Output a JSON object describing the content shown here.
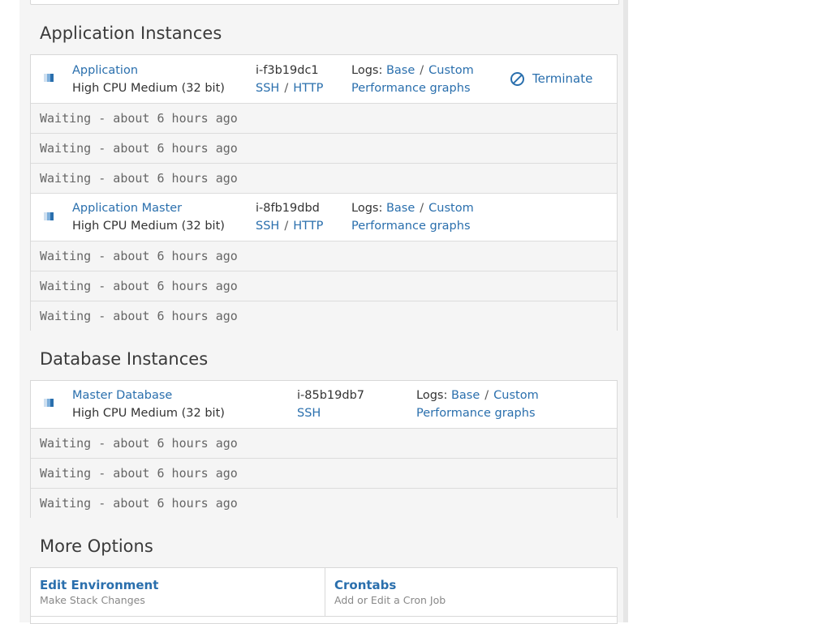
{
  "sections": {
    "application_title": "Application Instances",
    "database_title": "Database Instances",
    "options_title": "More Options"
  },
  "labels": {
    "logs": "Logs:",
    "base": "Base",
    "custom": "Custom",
    "slash": "/",
    "perf": "Performance graphs",
    "ssh": "SSH",
    "http": "HTTP",
    "terminate": "Terminate"
  },
  "app_instances": [
    {
      "name": "Application",
      "type": "High CPU Medium (32 bit)",
      "id": "i-f3b19dc1",
      "waits": [
        "Waiting - about 6 hours ago",
        "Waiting - about 6 hours ago",
        "Waiting - about 6 hours ago"
      ]
    },
    {
      "name": "Application Master",
      "type": "High CPU Medium (32 bit)",
      "id": "i-8fb19dbd",
      "waits": [
        "Waiting - about 6 hours ago",
        "Waiting - about 6 hours ago",
        "Waiting - about 6 hours ago"
      ]
    }
  ],
  "db_instances": [
    {
      "name": "Master Database",
      "type": "High CPU Medium (32 bit)",
      "id": "i-85b19db7",
      "waits": [
        "Waiting - about 6 hours ago",
        "Waiting - about 6 hours ago",
        "Waiting - about 6 hours ago"
      ]
    }
  ],
  "options": [
    {
      "title": "Edit Environment",
      "subtitle": "Make Stack Changes"
    },
    {
      "title": "Crontabs",
      "subtitle": "Add or Edit a Cron Job"
    }
  ],
  "colors": {
    "link": "#2a6fad",
    "status_light": "#cfe0f0",
    "status_mid": "#7fb0dc",
    "status_dark": "#2a6fad"
  },
  "icons": {
    "status": "instance-status-icon",
    "terminate": "ban-icon"
  }
}
